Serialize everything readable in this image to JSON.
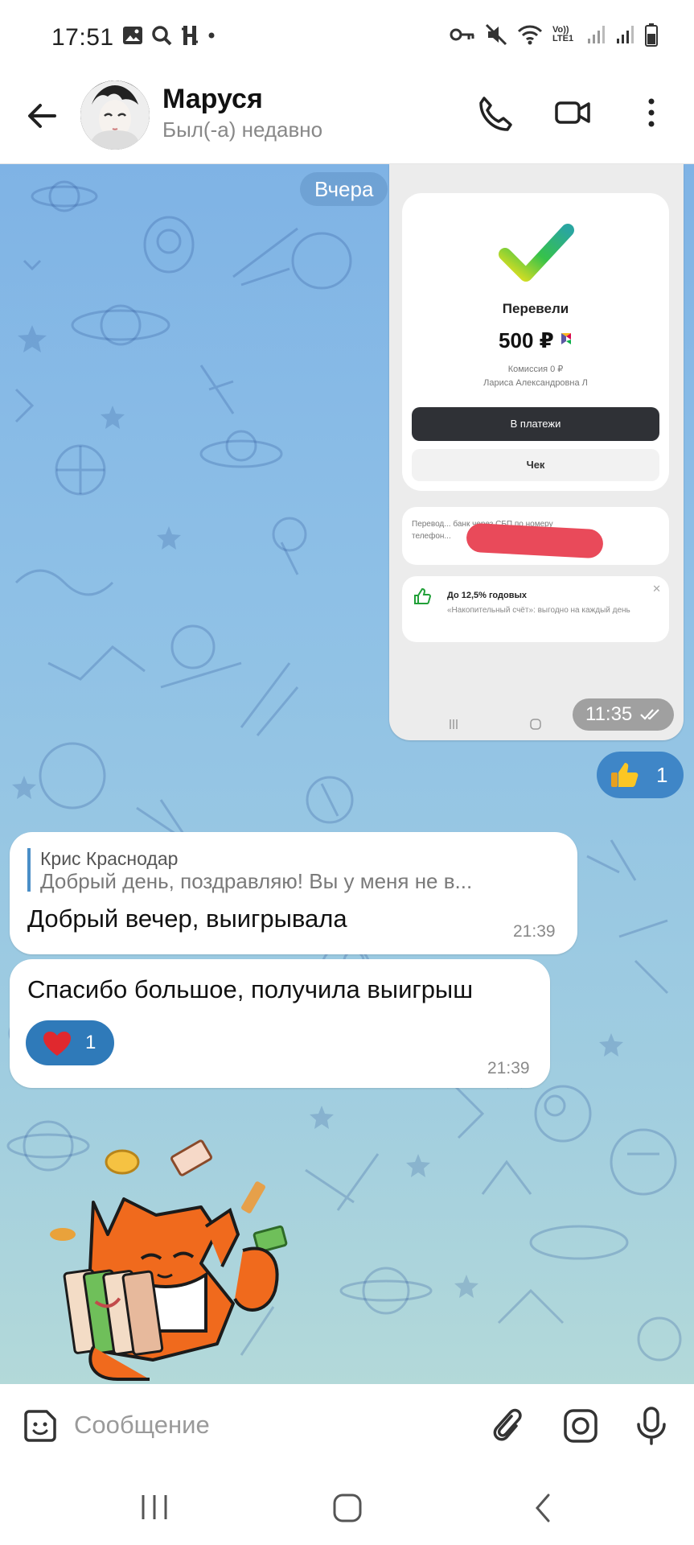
{
  "status_bar": {
    "time": "17:51",
    "left_icons": [
      "gallery-icon",
      "search-icon",
      "h-app-icon",
      "dot-icon"
    ],
    "right_icons": [
      "key-icon",
      "mute-icon",
      "wifi-icon",
      "volte-icon",
      "signal-icon",
      "signal-icon",
      "battery-icon"
    ],
    "volte_label": "Vo)) LTE1"
  },
  "header": {
    "contact_name": "Маруся",
    "contact_status": "Был(-а) недавно"
  },
  "chat": {
    "date_chip": "Вчера",
    "screenshot_message": {
      "title": "Перевели",
      "amount": "500 ₽",
      "fee": "Комиссия 0 ₽",
      "recipient": "Лариса Александровна Л",
      "primary_button": "В платежи",
      "secondary_button": "Чек",
      "info_line1": "Перевод... банк через СБП по номеру",
      "info_line2": "телефон...",
      "promo_title": "До 12,5% годовых",
      "promo_text": "«Накопительный счёт»: выгодно на каждый день",
      "time": "11:35"
    },
    "like_reaction": {
      "emoji": "thumbs-up-icon",
      "count": "1"
    },
    "reply_message": {
      "quote_author": "Крис Краснодар",
      "quote_text": "Добрый день, поздравляю!  Вы у меня не в...",
      "text": "Добрый вечер, выигрывала",
      "time": "21:39"
    },
    "thanks_message": {
      "text": "Спасибо большое, получила выигрыш",
      "reaction": {
        "emoji": "heart-icon",
        "count": "1"
      },
      "time": "21:39"
    },
    "sticker": "fox-with-money-sticker"
  },
  "composer": {
    "placeholder": "Сообщение"
  },
  "colors": {
    "chat_bg_top": "#7fb3e5",
    "chat_bg_bottom": "#b3d9d9",
    "reaction_blue": "#3f86c7",
    "quote_bar": "#4a8ec7",
    "redaction": "#e94a5a"
  }
}
